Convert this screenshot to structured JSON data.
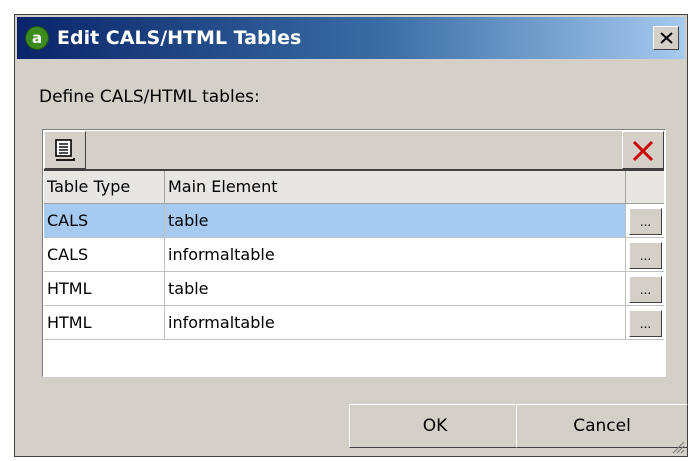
{
  "window": {
    "title": "Edit CALS/HTML Tables",
    "app_icon": "altova-logo-icon",
    "close_icon": "close-icon"
  },
  "define_label": "Define CALS/HTML tables:",
  "toolbar": {
    "insert_icon": "insert-row-icon",
    "delete_icon": "delete-row-icon",
    "delete_color": "#cc0000"
  },
  "table": {
    "columns": [
      "Table Type",
      "Main Element"
    ],
    "rows": [
      {
        "type": "CALS",
        "element": "table",
        "selected": true,
        "button": "..."
      },
      {
        "type": "CALS",
        "element": "informaltable",
        "selected": false,
        "button": "..."
      },
      {
        "type": "HTML",
        "element": "table",
        "selected": false,
        "button": "..."
      },
      {
        "type": "HTML",
        "element": "informaltable",
        "selected": false,
        "button": "..."
      }
    ]
  },
  "buttons": {
    "ok": "OK",
    "cancel": "Cancel"
  },
  "colors": {
    "selection": "#a6caf0",
    "title_start": "#0a246a",
    "title_end": "#a6caf0",
    "dialog_face": "#d4d0c8"
  }
}
